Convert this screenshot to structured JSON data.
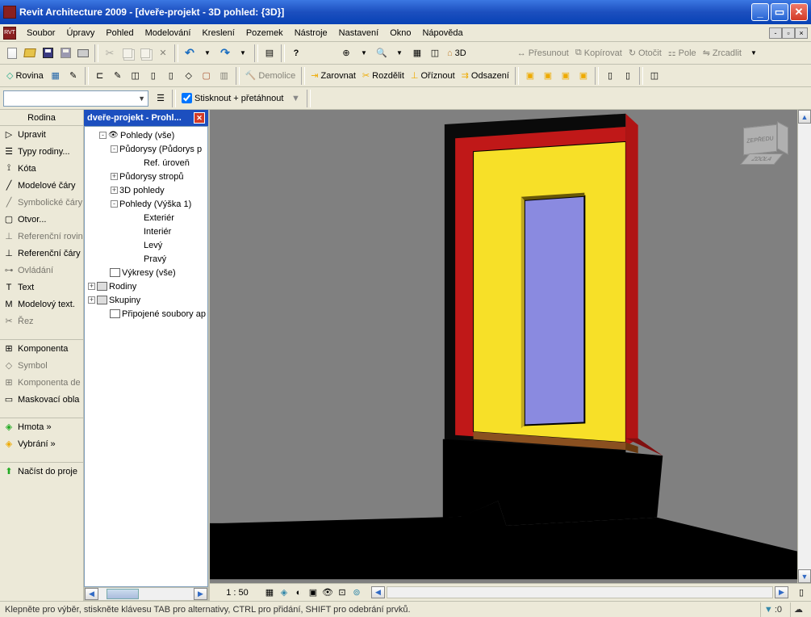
{
  "titlebar": {
    "text": "Revit Architecture 2009 - [dveře-projekt - 3D pohled: {3D}]"
  },
  "menu": [
    "Soubor",
    "Úpravy",
    "Pohled",
    "Modelování",
    "Kreslení",
    "Pozemek",
    "Nástroje",
    "Nastavení",
    "Okno",
    "Nápověda"
  ],
  "toolbar1": {
    "view3d": "3D",
    "move": "Přesunout",
    "copy": "Kopírovat",
    "rotate": "Otočit",
    "array": "Pole",
    "mirror": "Zrcadlit"
  },
  "toolbar2": {
    "plane": "Rovina",
    "demolish": "Demolice",
    "align": "Zarovnat",
    "split": "Rozdělit",
    "trim": "Oříznout",
    "offset": "Odsazení"
  },
  "toolbar3": {
    "checkbox": "Stisknout + přetáhnout"
  },
  "leftpanel": {
    "header": "Rodina",
    "items": [
      {
        "label": "Upravit",
        "interactable": true
      },
      {
        "label": "Typy rodiny...",
        "interactable": true
      },
      {
        "label": "Kóta",
        "interactable": true
      },
      {
        "label": "Modelové čáry",
        "interactable": true
      },
      {
        "label": "Symbolické čáry",
        "interactable": false
      },
      {
        "label": "Otvor...",
        "interactable": true
      },
      {
        "label": "Referenční rovina",
        "interactable": false
      },
      {
        "label": "Referenční čáry",
        "interactable": true
      },
      {
        "label": "Ovládání",
        "interactable": false
      },
      {
        "label": "Text",
        "interactable": true
      },
      {
        "label": "Modelový text.",
        "interactable": true
      },
      {
        "label": "Řez",
        "interactable": false
      }
    ],
    "items2": [
      {
        "label": "Komponenta",
        "interactable": true
      },
      {
        "label": "Symbol",
        "interactable": false
      },
      {
        "label": "Komponenta de",
        "interactable": false
      },
      {
        "label": "Maskovací obla",
        "interactable": true
      }
    ],
    "items3": [
      {
        "label": "Hmota »",
        "interactable": true
      },
      {
        "label": "Vybrání »",
        "interactable": true
      }
    ],
    "items4": [
      {
        "label": "Načíst do proje",
        "interactable": true
      }
    ]
  },
  "tree": {
    "title": "dveře-projekt - Prohl...",
    "nodes": [
      {
        "level": 2,
        "exp": "-",
        "label": "Pohledy (vše)",
        "icon": "eye"
      },
      {
        "level": 3,
        "exp": "-",
        "label": "Půdorysy (Půdorys p"
      },
      {
        "level": 5,
        "exp": "",
        "label": "Ref. úroveň"
      },
      {
        "level": 3,
        "exp": "+",
        "label": "Půdorysy stropů"
      },
      {
        "level": 3,
        "exp": "+",
        "label": "3D pohledy"
      },
      {
        "level": 3,
        "exp": "-",
        "label": "Pohledy (Výška 1)"
      },
      {
        "level": 5,
        "exp": "",
        "label": "Exteriér"
      },
      {
        "level": 5,
        "exp": "",
        "label": "Interiér"
      },
      {
        "level": 5,
        "exp": "",
        "label": "Levý"
      },
      {
        "level": 5,
        "exp": "",
        "label": "Pravý"
      },
      {
        "level": 2,
        "exp": "",
        "label": "Výkresy (vše)",
        "icon": "sq"
      },
      {
        "level": 1,
        "exp": "+",
        "label": "Rodiny",
        "icon": "grp"
      },
      {
        "level": 1,
        "exp": "+",
        "label": "Skupiny",
        "icon": "grp"
      },
      {
        "level": 2,
        "exp": "",
        "label": "Připojené soubory ap",
        "icon": "sq"
      }
    ]
  },
  "view": {
    "scale": "1 : 50"
  },
  "navcube": {
    "front": "ZEPŘEDU",
    "bottom": "ZDOLA"
  },
  "statusbar": {
    "text": "Klepněte pro výběr, stiskněte klávesu TAB pro alternativy, CTRL pro přidání, SHIFT pro odebrání prvků.",
    "filter": ":0"
  }
}
